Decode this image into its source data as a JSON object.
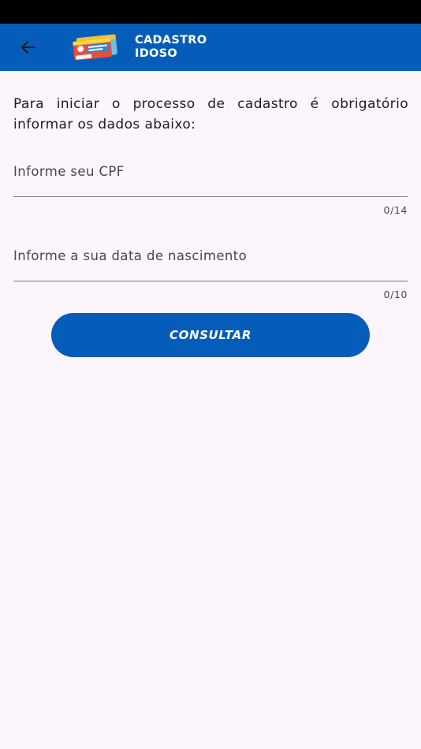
{
  "app_bar": {
    "title_line1": "CADASTRO",
    "title_line2": "IDOSO",
    "back_icon": "arrow-left-icon",
    "logo_icon": "program-logo-icon"
  },
  "form": {
    "intro_text": "Para iniciar o processo de cadastro é obrigatório informar os dados abaixo:",
    "cpf": {
      "label": "Informe seu CPF",
      "counter": "0/14"
    },
    "birthdate": {
      "label": "Informe a sua data de nascimento",
      "counter": "0/10"
    },
    "submit_label": "CONSULTAR"
  },
  "colors": {
    "primary": "#065db9",
    "background": "#fcf6fc",
    "status_bar": "#000000"
  }
}
